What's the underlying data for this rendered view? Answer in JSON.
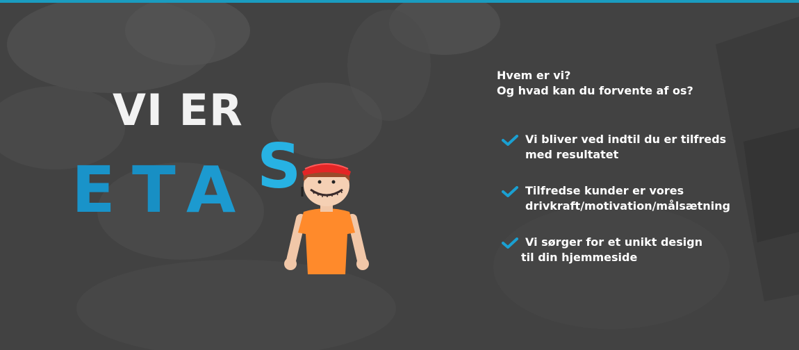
{
  "hero": {
    "title": "VI ER",
    "brand_letters": [
      "E",
      "T",
      "A",
      "S"
    ]
  },
  "intro": {
    "line1": "Hvem er vi?",
    "line2": "Og hvad kan du forvente af os?"
  },
  "features": [
    {
      "icon": "check-icon",
      "line1": "Vi bliver ved indtil du er tilfreds",
      "line2": "med resultatet"
    },
    {
      "icon": "check-icon",
      "line1": "Tilfredse kunder er vores",
      "line2": "drivkraft/motivation/målsætning"
    },
    {
      "icon": "check-icon",
      "line1": "Vi sørger for et unikt design",
      "line2": "til din hjemmeside"
    }
  ],
  "colors": {
    "accent": "#1a9cc0",
    "check": "#1aa0d2",
    "background": "#4a4a4a",
    "mascot_shirt": "#ff8a2b",
    "mascot_hat": "#e32626"
  }
}
